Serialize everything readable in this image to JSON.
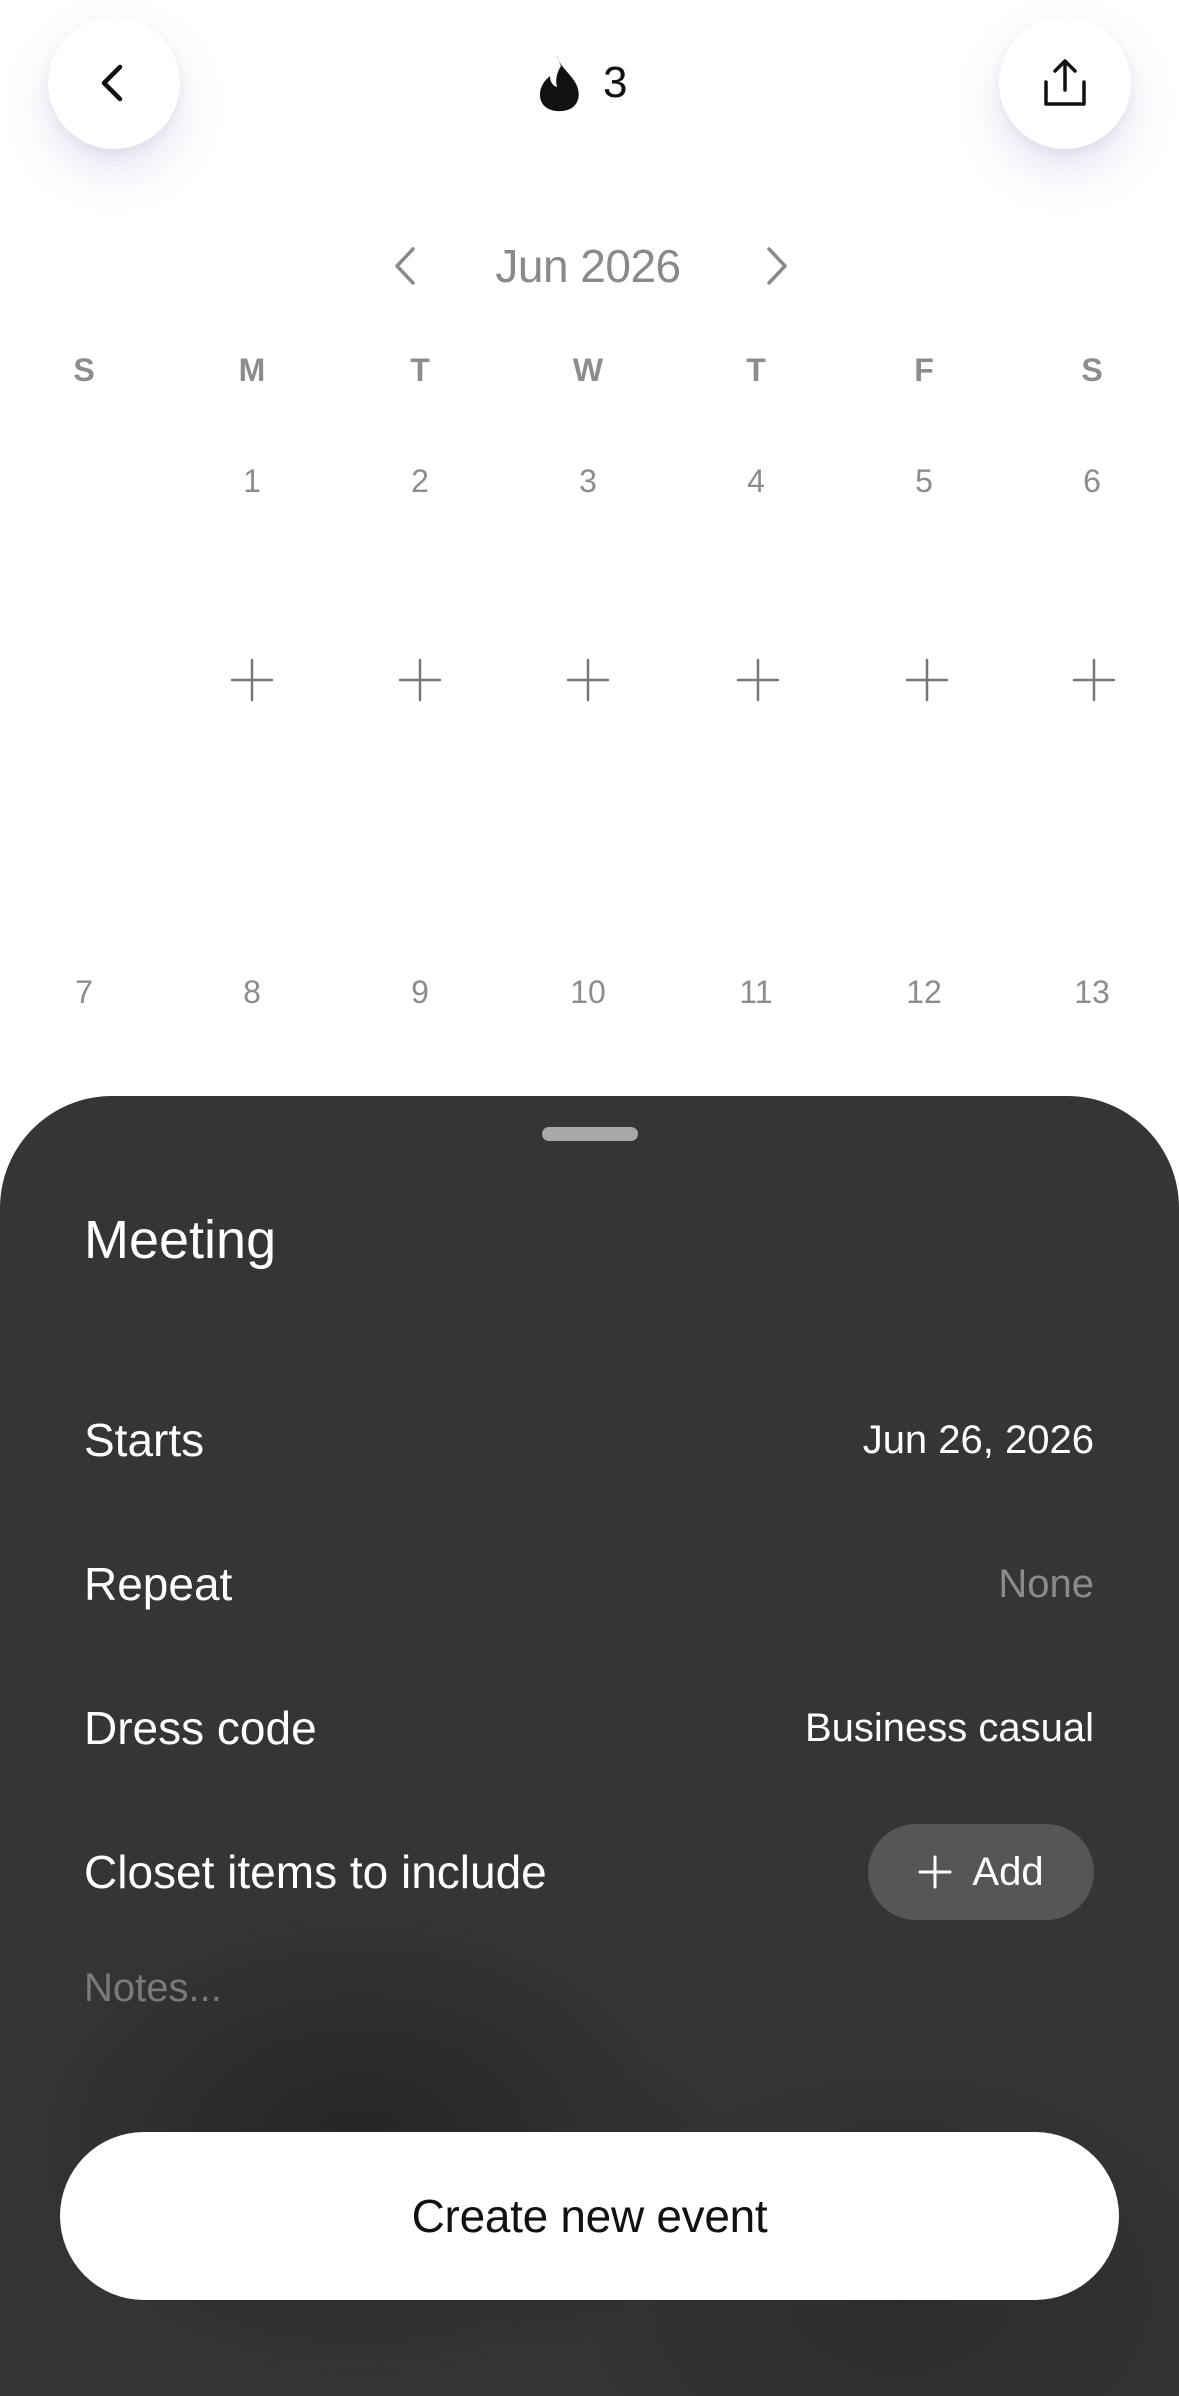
{
  "header": {
    "back_icon": "chevron-left-icon",
    "streak_icon": "flame-icon",
    "streak_count": "3",
    "share_icon": "share-icon"
  },
  "calendar": {
    "month_label": "Jun 2026",
    "prev_icon": "chevron-left-icon",
    "next_icon": "chevron-right-icon",
    "weekdays": [
      "S",
      "M",
      "T",
      "W",
      "T",
      "F",
      "S"
    ],
    "weeks": [
      [
        "",
        "1",
        "2",
        "3",
        "4",
        "5",
        "6"
      ],
      [
        "7",
        "8",
        "9",
        "10",
        "11",
        "12",
        "13"
      ]
    ],
    "add_icon": "plus-icon"
  },
  "sheet": {
    "title": "Meeting",
    "starts": {
      "label": "Starts",
      "value": "Jun 26, 2026"
    },
    "repeat": {
      "label": "Repeat",
      "value": "None"
    },
    "dress_code": {
      "label": "Dress code",
      "value": "Business casual"
    },
    "closet": {
      "label": "Closet items to include",
      "add_label": "Add"
    },
    "notes_placeholder": "Notes...",
    "create_label": "Create new event"
  },
  "colors": {
    "sheet_background": "#353535",
    "muted_text": "#8d8d8d",
    "add_button": "#565656"
  }
}
